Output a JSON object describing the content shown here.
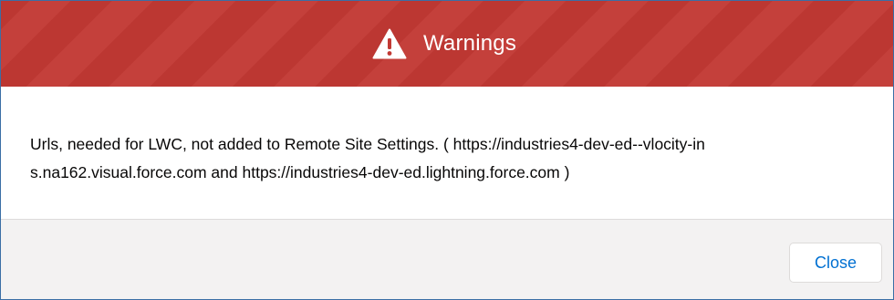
{
  "modal": {
    "title": "Warnings",
    "icon": "warning-icon",
    "message_line1": "Urls, needed for LWC, not added to Remote Site Settings. ( https://industries4-dev-ed--vlocity-in",
    "message_line2": "s.na162.visual.force.com and https://industries4-dev-ed.lightning.force.com )",
    "close_label": "Close"
  },
  "colors": {
    "header_bg": "#c23934",
    "footer_bg": "#f3f2f2",
    "button_text": "#0070d2",
    "border": "#3b6ea5"
  }
}
